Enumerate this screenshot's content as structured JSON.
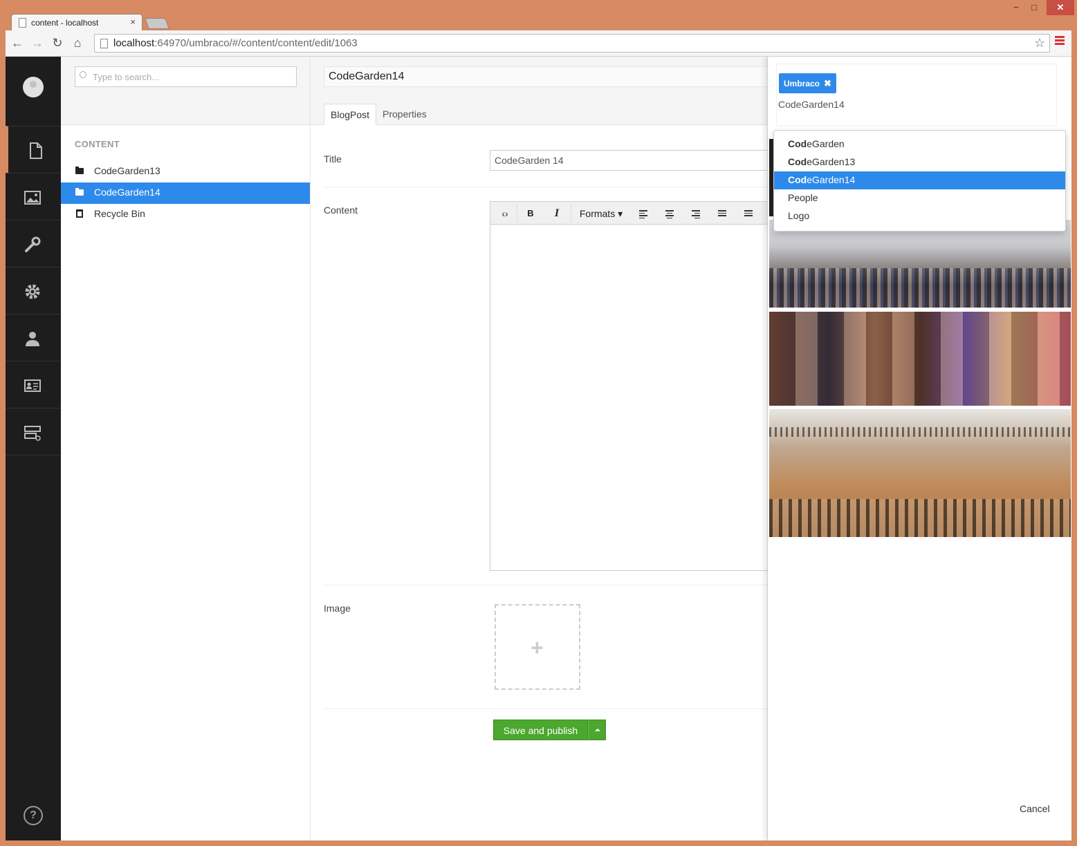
{
  "browser": {
    "tab_title": "content - localhost",
    "tab_close": "×",
    "url_host": "localhost",
    "url_rest": ":64970/umbraco/#/content/content/edit/1063",
    "window_min": "−",
    "window_max": "□",
    "window_close": "✕"
  },
  "sections": [
    "user",
    "content",
    "media",
    "developer",
    "settings",
    "users",
    "members",
    "forms"
  ],
  "help_label": "?",
  "tree": {
    "search_placeholder": "Type to search...",
    "section_label": "CONTENT",
    "nodes": [
      {
        "label": "CodeGarden13",
        "icon": "folder-icon"
      },
      {
        "label": "CodeGarden14",
        "icon": "folder-icon",
        "selected": true
      },
      {
        "label": "Recycle Bin",
        "icon": "trash-icon"
      }
    ]
  },
  "editor": {
    "node_name": "CodeGarden14",
    "tabs": [
      "BlogPost",
      "Properties"
    ],
    "title_label": "Title",
    "title_value": "CodeGarden 14",
    "content_label": "Content",
    "image_label": "Image",
    "toolbar": {
      "source": "‹›",
      "bold": "B",
      "italic": "I",
      "formats": "Formats ▾"
    },
    "save_publish": "Save and publish"
  },
  "dialog": {
    "tag": "Umbraco",
    "tag_remove": "✖",
    "typed": "CodeGarden14",
    "suggestions": [
      {
        "match": "Cod",
        "rest": "eGarden"
      },
      {
        "match": "Cod",
        "rest": "eGarden13"
      },
      {
        "match": "Cod",
        "rest": "eGarden14",
        "selected": true
      },
      {
        "match": "",
        "rest": "People"
      },
      {
        "match": "",
        "rest": "Logo"
      }
    ],
    "cancel": "Cancel"
  },
  "colors": {
    "accent": "#2e8aea",
    "publish": "#4ca72e",
    "active_section": "#d88a62",
    "nav_bg": "#1d1d1d"
  }
}
